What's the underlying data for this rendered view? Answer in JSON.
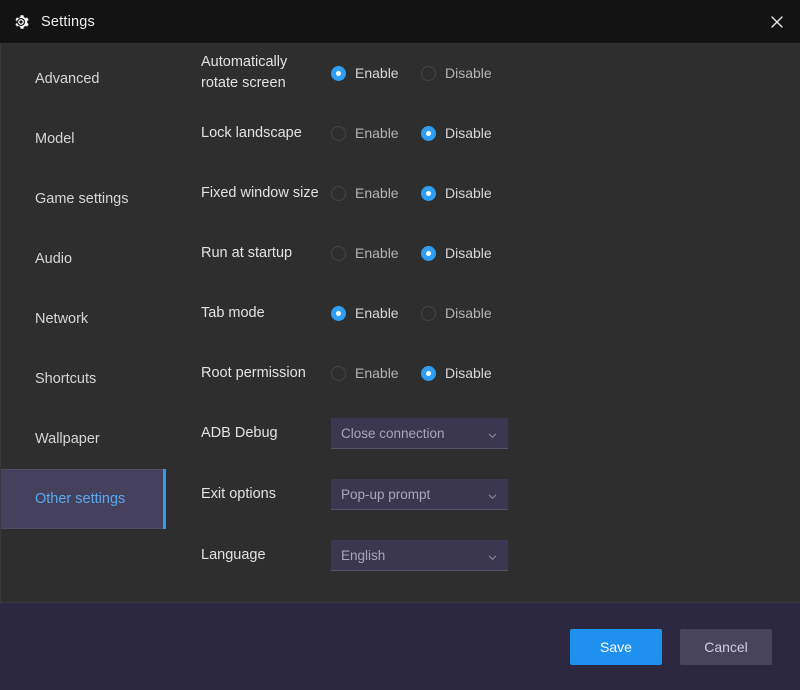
{
  "titlebar": {
    "title": "Settings",
    "gear_icon": "gear-icon",
    "close_icon": "close-icon"
  },
  "colors": {
    "accent_blue": "#2f9df4",
    "save_blue": "#1e90ef",
    "selected_bg": "#45415c",
    "panel_bg": "#2e2e2e",
    "footer_bg": "#2b2840",
    "titlebar_bg": "#131313"
  },
  "sidebar": {
    "items": [
      {
        "label": "Advanced",
        "selected": false
      },
      {
        "label": "Model",
        "selected": false
      },
      {
        "label": "Game settings",
        "selected": false
      },
      {
        "label": "Audio",
        "selected": false
      },
      {
        "label": "Network",
        "selected": false
      },
      {
        "label": "Shortcuts",
        "selected": false
      },
      {
        "label": "Wallpaper",
        "selected": false
      },
      {
        "label": "Other settings",
        "selected": true
      }
    ]
  },
  "main": {
    "radio_rows": [
      {
        "label": "Automatically rotate screen",
        "enable_label": "Enable",
        "disable_label": "Disable",
        "selected": "enable"
      },
      {
        "label": "Lock landscape",
        "enable_label": "Enable",
        "disable_label": "Disable",
        "selected": "disable"
      },
      {
        "label": "Fixed window size",
        "enable_label": "Enable",
        "disable_label": "Disable",
        "selected": "disable"
      },
      {
        "label": "Run at startup",
        "enable_label": "Enable",
        "disable_label": "Disable",
        "selected": "disable"
      },
      {
        "label": "Tab mode",
        "enable_label": "Enable",
        "disable_label": "Disable",
        "selected": "enable"
      },
      {
        "label": "Root permission",
        "enable_label": "Enable",
        "disable_label": "Disable",
        "selected": "disable"
      }
    ],
    "select_rows": [
      {
        "label": "ADB Debug",
        "value": "Close connection",
        "chevron_icon": "chevron-down-icon"
      },
      {
        "label": "Exit options",
        "value": "Pop-up prompt",
        "chevron_icon": "chevron-down-icon"
      },
      {
        "label": "Language",
        "value": "English",
        "chevron_icon": "chevron-down-icon"
      }
    ]
  },
  "footer": {
    "save_label": "Save",
    "cancel_label": "Cancel"
  }
}
